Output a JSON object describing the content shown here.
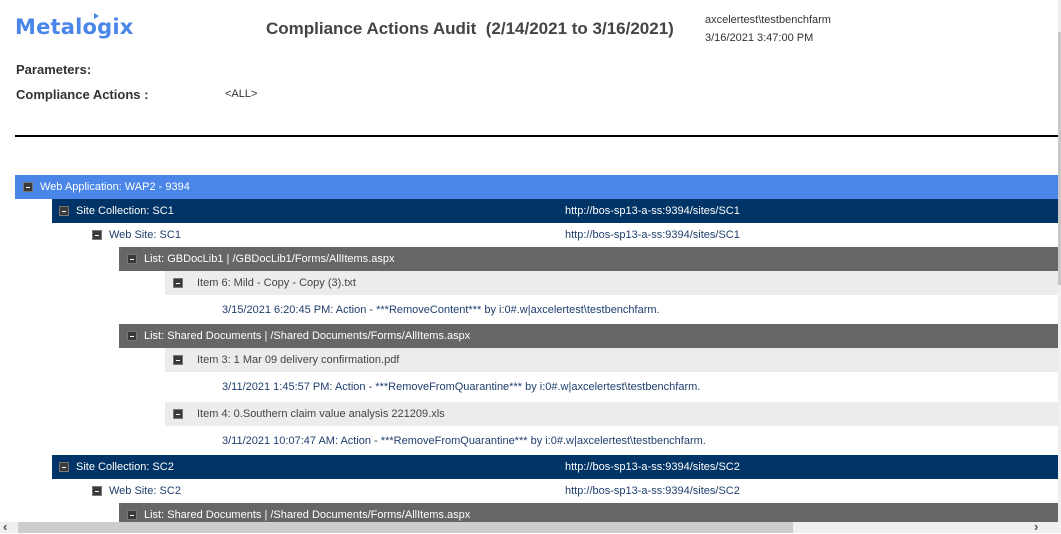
{
  "header": {
    "logo_text": "Metalogix",
    "title": "Compliance Actions Audit  (2/14/2021 to 3/16/2021)",
    "user": "axcelertest\\testbenchfarm",
    "generated": "3/16/2021 3:47:00 PM"
  },
  "parameters": {
    "label": "Parameters:",
    "compliance_actions_label": "Compliance Actions :",
    "compliance_actions_value": "<ALL>"
  },
  "colors": {
    "web_application": "#4a86e8",
    "site_collection": "#003366",
    "list": "#666666",
    "item": "#ececec",
    "link_text": "#1f3f6e"
  },
  "tree": {
    "web_application": "Web Application: WAP2 - 9394",
    "sc1": {
      "label": "Site Collection: SC1",
      "url": "http://bos-sp13-a-ss:9394/sites/SC1"
    },
    "ws1": {
      "label": "Web Site: SC1",
      "url": "http://bos-sp13-a-ss:9394/sites/SC1"
    },
    "list1": {
      "label": "List:  GBDocLib1 | /GBDocLib1/Forms/AllItems.aspx"
    },
    "item6": {
      "label": "Item 6: Mild - Copy - Copy (3).txt",
      "action": "3/15/2021 6:20:45 PM: Action - ***RemoveContent*** by i:0#.w|axcelertest\\testbenchfarm."
    },
    "list2": {
      "label": "List:  Shared Documents | /Shared Documents/Forms/AllItems.aspx"
    },
    "item3": {
      "label": "Item 3: 1  Mar 09 delivery confirmation.pdf",
      "action": "3/11/2021 1:45:57 PM: Action - ***RemoveFromQuarantine*** by i:0#.w|axcelertest\\testbenchfarm."
    },
    "item4": {
      "label": "Item 4: 0.Southern claim value analysis 221209.xls",
      "action": "3/11/2021 10:07:47 AM: Action - ***RemoveFromQuarantine*** by i:0#.w|axcelertest\\testbenchfarm."
    },
    "sc2": {
      "label": "Site Collection: SC2",
      "url": "http://bos-sp13-a-ss:9394/sites/SC2"
    },
    "ws2": {
      "label": "Web Site: SC2",
      "url": "http://bos-sp13-a-ss:9394/sites/SC2"
    },
    "list3": {
      "label": "List:  Shared Documents | /Shared Documents/Forms/AllItems.aspx"
    }
  },
  "scrollbar": {
    "left_arrow": "‹",
    "right_arrow": "›"
  }
}
